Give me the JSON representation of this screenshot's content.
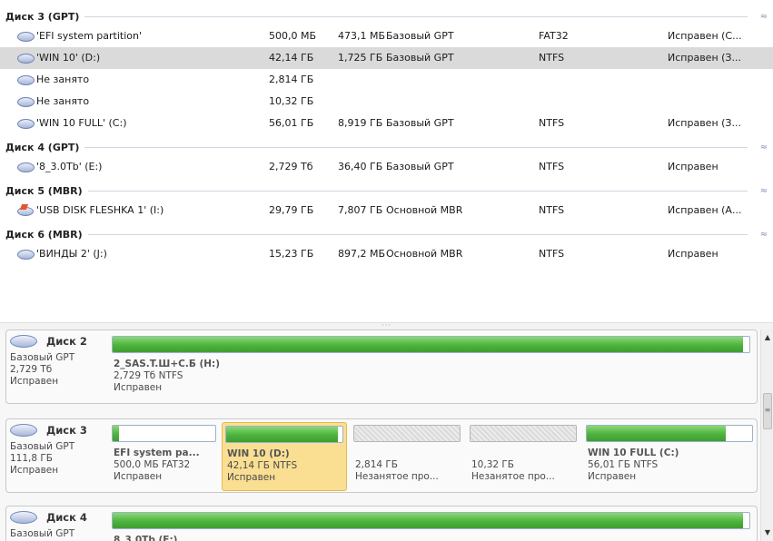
{
  "volumes": {
    "groups": [
      {
        "title": "Диск 3 (GPT)",
        "rows": [
          {
            "name": "'EFI system partition'",
            "capacity": "500,0 МБ",
            "free": "473,1 МБ",
            "type": "Базовый GPT",
            "fs": "FAT32",
            "status": "Исправен (С...",
            "icon": "disk-icon"
          },
          {
            "name": "'WIN 10' (D:)",
            "capacity": "42,14 ГБ",
            "free": "1,725 ГБ",
            "type": "Базовый GPT",
            "fs": "NTFS",
            "status": "Исправен (З...",
            "icon": "disk-icon",
            "selected": true
          },
          {
            "name": "Не занято",
            "capacity": "2,814 ГБ",
            "free": "",
            "type": "",
            "fs": "",
            "status": "",
            "icon": "disk-icon"
          },
          {
            "name": "Не занято",
            "capacity": "10,32 ГБ",
            "free": "",
            "type": "",
            "fs": "",
            "status": "",
            "icon": "disk-icon"
          },
          {
            "name": "'WIN 10 FULL' (C:)",
            "capacity": "56,01 ГБ",
            "free": "8,919 ГБ",
            "type": "Базовый GPT",
            "fs": "NTFS",
            "status": "Исправен (З...",
            "icon": "disk-icon"
          }
        ]
      },
      {
        "title": "Диск 4 (GPT)",
        "rows": [
          {
            "name": "'8_3.0Tb' (E:)",
            "capacity": "2,729 Тб",
            "free": "36,40 ГБ",
            "type": "Базовый GPT",
            "fs": "NTFS",
            "status": "Исправен",
            "icon": "disk-icon"
          }
        ]
      },
      {
        "title": "Диск 5 (MBR)",
        "rows": [
          {
            "name": "'USB DISK FLESHKA 1' (I:)",
            "capacity": "29,79 ГБ",
            "free": "7,807 ГБ",
            "type": "Основной MBR",
            "fs": "NTFS",
            "status": "Исправен (А...",
            "icon": "usb-icon"
          }
        ]
      },
      {
        "title": "Диск 6 (MBR)",
        "rows": [
          {
            "name": "'ВИНДЫ 2' (J:)",
            "capacity": "15,23 ГБ",
            "free": "897,2 МБ",
            "type": "Основной MBR",
            "fs": "NTFS",
            "status": "Исправен",
            "icon": "disk-icon"
          }
        ]
      }
    ]
  },
  "map": {
    "disks": [
      {
        "name": "Диск 2",
        "meta": [
          "Базовый GPT",
          "2,729 Тб",
          "Исправен"
        ],
        "partitions": [
          {
            "name": "2_SAS.T.Ш+С.Б (H:)",
            "size": "2,729 Тб NTFS",
            "status": "Исправен",
            "used_fraction": 0.99,
            "kind": "used"
          }
        ]
      },
      {
        "name": "Диск 3",
        "meta": [
          "Базовый GPT",
          "111,8 ГБ",
          "Исправен"
        ],
        "partitions": [
          {
            "name": "EFI system pa...",
            "size": "500,0 МБ FAT32",
            "status": "Исправен",
            "used_fraction": 0.06,
            "kind": "used"
          },
          {
            "name": "WIN 10 (D:)",
            "size": "42,14 ГБ NTFS",
            "status": "Исправен",
            "used_fraction": 0.96,
            "kind": "used",
            "selected": true
          },
          {
            "name": "",
            "size": "2,814 ГБ",
            "status": "Незанятое про...",
            "used_fraction": 0,
            "kind": "unallocated"
          },
          {
            "name": "",
            "size": "10,32 ГБ",
            "status": "Незанятое про...",
            "used_fraction": 0,
            "kind": "unallocated"
          },
          {
            "name": "WIN 10 FULL (C:)",
            "size": "56,01 ГБ NTFS",
            "status": "Исправен",
            "used_fraction": 0.84,
            "kind": "used"
          }
        ]
      },
      {
        "name": "Диск 4",
        "meta": [
          "Базовый GPT"
        ],
        "partitions": [
          {
            "name": "8_3.0Tb (E:)",
            "size": "",
            "status": "",
            "used_fraction": 0.99,
            "kind": "used"
          }
        ]
      }
    ]
  },
  "icons": {
    "splitter_grip": "···",
    "collapse": "≈",
    "scroll_up": "▲",
    "scroll_down": "▼",
    "scroll_grip": "≡"
  }
}
